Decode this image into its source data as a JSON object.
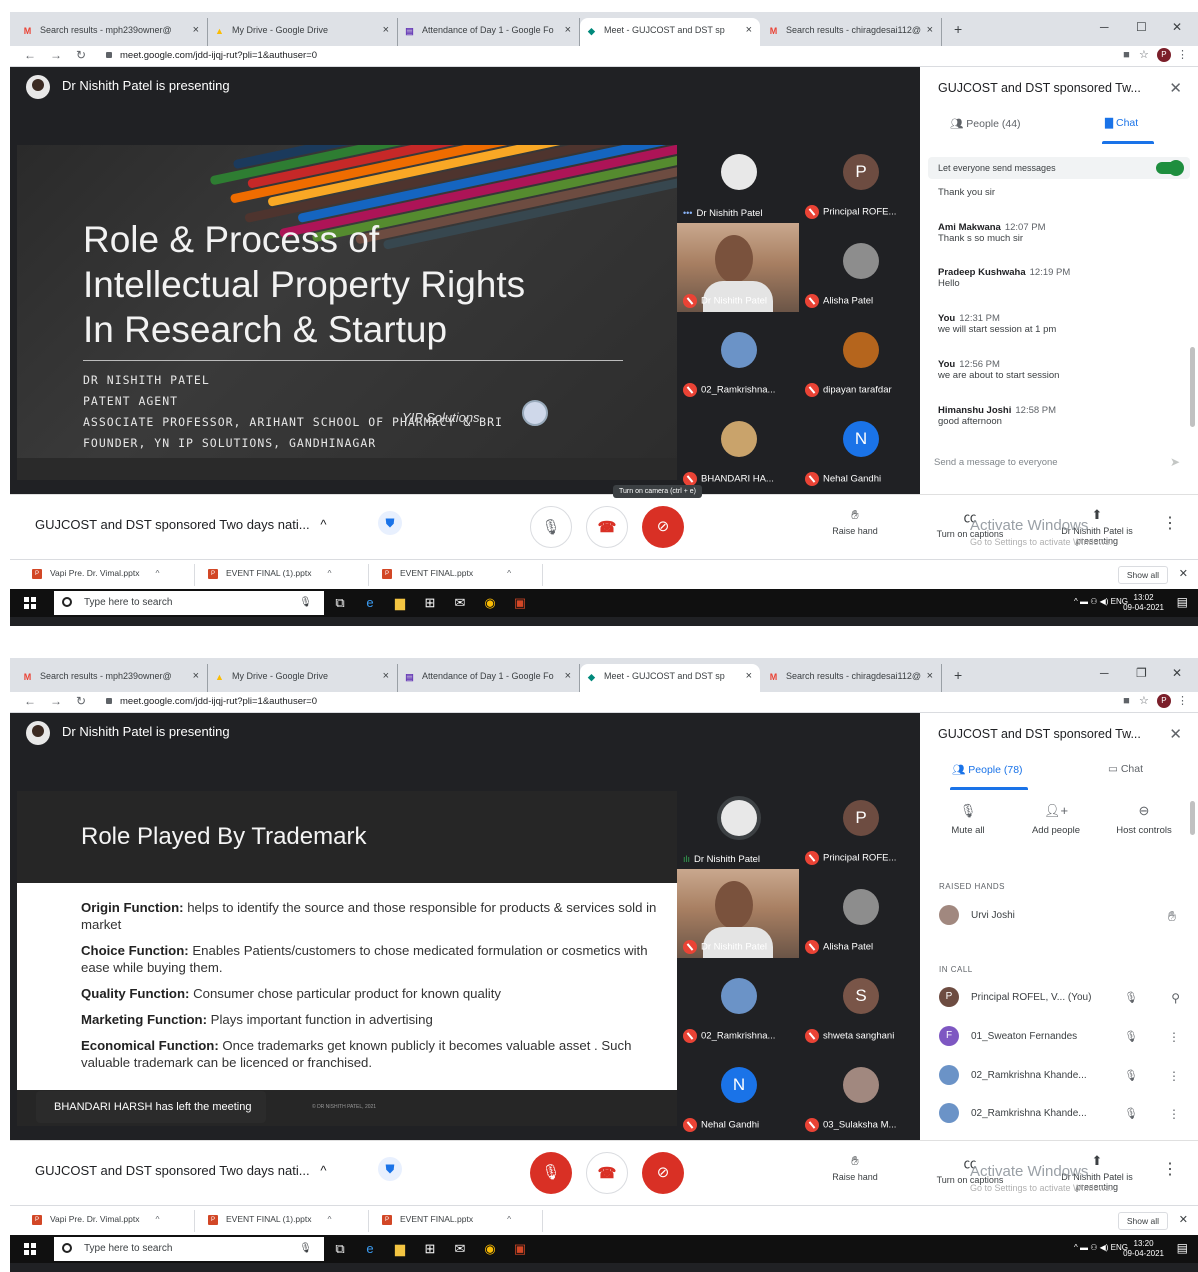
{
  "browser": {
    "tabs": [
      {
        "label": "Search results - mph239owner@",
        "fav": "M",
        "fav_color": "#ea4335"
      },
      {
        "label": "My Drive - Google Drive",
        "fav": "▲",
        "fav_color": "#fbbc04"
      },
      {
        "label": "Attendance of Day 1 - Google Fo",
        "fav": "▤",
        "fav_color": "#673ab7"
      },
      {
        "label": "Meet - GUJCOST and DST sp",
        "fav": "◆",
        "fav_color": "#00897b"
      },
      {
        "label": "Search results - chiragdesai112@",
        "fav": "M",
        "fav_color": "#ea4335"
      }
    ],
    "close_glyph": "×",
    "new_tab": "+",
    "url": "meet.google.com/jdd-ijqj-rut?pli=1&authuser=0",
    "profile_letter": "P"
  },
  "meet": {
    "presenting_text": "Dr Nishith Patel is presenting",
    "meeting_name": "GUJCOST and DST sponsored Two days nati...",
    "raise_hand": "Raise hand",
    "captions": "Turn on captions",
    "presenting_btn": "Dr Nishith Patel is presenting",
    "activate": "Activate Windows",
    "activate_sub": "Go to Settings to activate Windows.",
    "panel_title": "GUJCOST and DST sponsored Tw...",
    "chat_label": "Chat"
  },
  "shot1": {
    "slide": {
      "title_lines": [
        "Role & Process of",
        "Intellectual Property Rights",
        "In Research & Startup"
      ],
      "author_lines": [
        "DR NISHITH PATEL",
        "PATENT AGENT",
        "ASSOCIATE PROFESSOR, ARIHANT SCHOOL OF PHARMACY & BRI",
        "FOUNDER, YN IP SOLUTIONS, GANDHINAGAR"
      ],
      "logo_text": "YIP Solutions"
    },
    "tiles": [
      {
        "name": "Dr Nishith Patel",
        "muted": false,
        "avatar": "",
        "color": "#e8e8e8"
      },
      {
        "name": "Principal ROFE...",
        "muted": true,
        "avatar": "P",
        "color": "#6d4c41"
      },
      {
        "name": "Dr Nishith Patel",
        "muted": true,
        "avatar": "",
        "color": "video"
      },
      {
        "name": "Alisha Patel",
        "muted": true,
        "avatar": "",
        "color": "#8d8d8d"
      },
      {
        "name": "02_Ramkrishna...",
        "muted": true,
        "avatar": "",
        "color": "#6b93c7"
      },
      {
        "name": "dipayan tarafdar",
        "muted": true,
        "avatar": "",
        "color": "#b5651d"
      },
      {
        "name": "BHANDARI HA...",
        "muted": true,
        "avatar": "",
        "color": "#c9a36b"
      },
      {
        "name": "Nehal Gandhi",
        "muted": true,
        "avatar": "N",
        "color": "#1a73e8"
      }
    ],
    "people_tab": "People (44)",
    "toggle_label": "Let everyone send messages",
    "messages": [
      {
        "who": "",
        "time": "",
        "text": "Thank you sir"
      },
      {
        "who": "Ami Makwana",
        "time": "12:07 PM",
        "text": "Thank s so much sir"
      },
      {
        "who": "Pradeep Kushwaha",
        "time": "12:19 PM",
        "text": "Hello"
      },
      {
        "who": "You",
        "time": "12:31 PM",
        "text": "we will start session at 1 pm"
      },
      {
        "who": "You",
        "time": "12:56 PM",
        "text": "we are about to start session"
      },
      {
        "who": "Himanshu Joshi",
        "time": "12:58 PM",
        "text": "good afternoon"
      }
    ],
    "chat_placeholder": "Send a message to everyone",
    "tooltip": "Turn on camera (ctrl + e)",
    "clock_time": "13:02",
    "clock_date": "09-04-2021"
  },
  "shot2": {
    "slide": {
      "title": "Role Played By Trademark",
      "items": [
        {
          "head": "Origin Function:",
          "text": " helps to identify the source and those responsible for products & services sold in market"
        },
        {
          "head": "Choice Function:",
          "text": " Enables Patients/customers to chose medicated formulation or cosmetics with ease while buying them."
        },
        {
          "head": "Quality Function:",
          "text": " Consumer chose particular product for known quality"
        },
        {
          "head": "Marketing Function:",
          "text": " Plays important function in advertising"
        },
        {
          "head": "Economical Function:",
          "text": " Once trademarks get known publicly it becomes valuable asset . Such valuable trademark can be licenced or franchised."
        }
      ],
      "copyright": "© DR NISHITH PATEL, 2021"
    },
    "toast": "BHANDARI HARSH has left the meeting",
    "tiles": [
      {
        "name": "Dr Nishith Patel",
        "muted": false,
        "avatar": "",
        "color": "#e8e8e8"
      },
      {
        "name": "Principal ROFE...",
        "muted": true,
        "avatar": "P",
        "color": "#6d4c41"
      },
      {
        "name": "Dr Nishith Patel",
        "muted": true,
        "avatar": "",
        "color": "video"
      },
      {
        "name": "Alisha Patel",
        "muted": true,
        "avatar": "",
        "color": "#8d8d8d"
      },
      {
        "name": "02_Ramkrishna...",
        "muted": true,
        "avatar": "",
        "color": "#6b93c7"
      },
      {
        "name": "shweta sanghani",
        "muted": true,
        "avatar": "S",
        "color": "#795548"
      },
      {
        "name": "Nehal Gandhi",
        "muted": true,
        "avatar": "N",
        "color": "#1a73e8"
      },
      {
        "name": "03_Sulaksha M...",
        "muted": true,
        "avatar": "",
        "color": "#a1887f"
      }
    ],
    "people_tab": "People (78)",
    "actions": [
      "Mute all",
      "Add people",
      "Host controls"
    ],
    "raised_label": "RAISED HANDS",
    "raised": "Urvi Joshi",
    "incall_label": "IN CALL",
    "people": [
      {
        "name": "Principal ROFEL, V... (You)",
        "avatar": "P",
        "color": "#6d4c41"
      },
      {
        "name": "01_Sweaton Fernandes",
        "avatar": "F",
        "color": "#7e57c2"
      },
      {
        "name": "02_Ramkrishna Khande...",
        "avatar": "",
        "color": "#6b93c7"
      },
      {
        "name": "02_Ramkrishna Khande...",
        "avatar": "",
        "color": "#6b93c7"
      }
    ],
    "clock_time": "13:20",
    "clock_date": "09-04-2021"
  },
  "downloads": [
    {
      "name": "Vapi Pre. Dr. Vimal.pptx"
    },
    {
      "name": "EVENT FINAL (1).pptx"
    },
    {
      "name": "EVENT FINAL.pptx"
    }
  ],
  "downloads_show_all": "Show all",
  "taskbar": {
    "search_placeholder": "Type here to search",
    "lang": "ENG"
  }
}
